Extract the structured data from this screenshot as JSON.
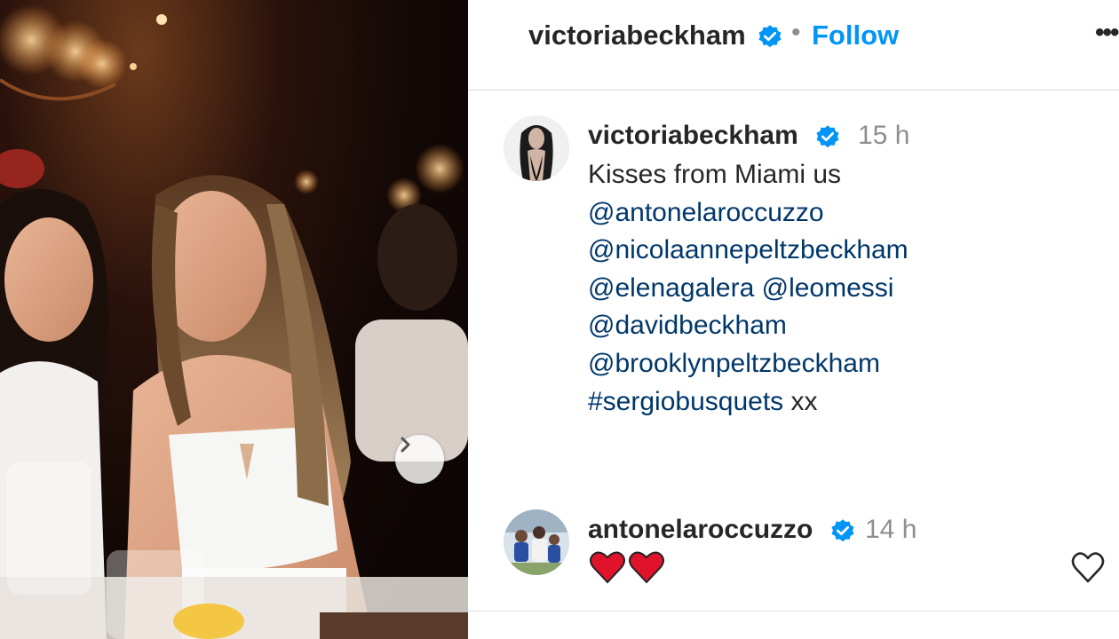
{
  "header": {
    "username": "victoriabeckham",
    "separator": "•",
    "follow_label": "Follow",
    "more_label": "•••"
  },
  "photo": {
    "next_button_icon": "chevron-right-icon"
  },
  "caption_comment": {
    "username": "victoriabeckham",
    "time": "15 h",
    "text": "Kisses from Miami us",
    "mentions": [
      "@antonelaroccuzzo",
      "@nicolaannepeltzbeckham",
      "@elenagalera",
      "@leomessi",
      "@davidbeckham",
      "@brooklynpeltzbeckham",
      "#sergiobusquets"
    ],
    "suffix": "xx"
  },
  "reply_comment": {
    "username": "antonelaroccuzzo",
    "time": "14 h",
    "text": "❤️❤️",
    "like_icon": "heart-outline-icon"
  },
  "colors": {
    "accent": "#0095f6",
    "link": "#00376b",
    "text": "#262626",
    "muted": "#8e8e8e",
    "verified": "#0095f6",
    "heart": "#e0132a"
  }
}
